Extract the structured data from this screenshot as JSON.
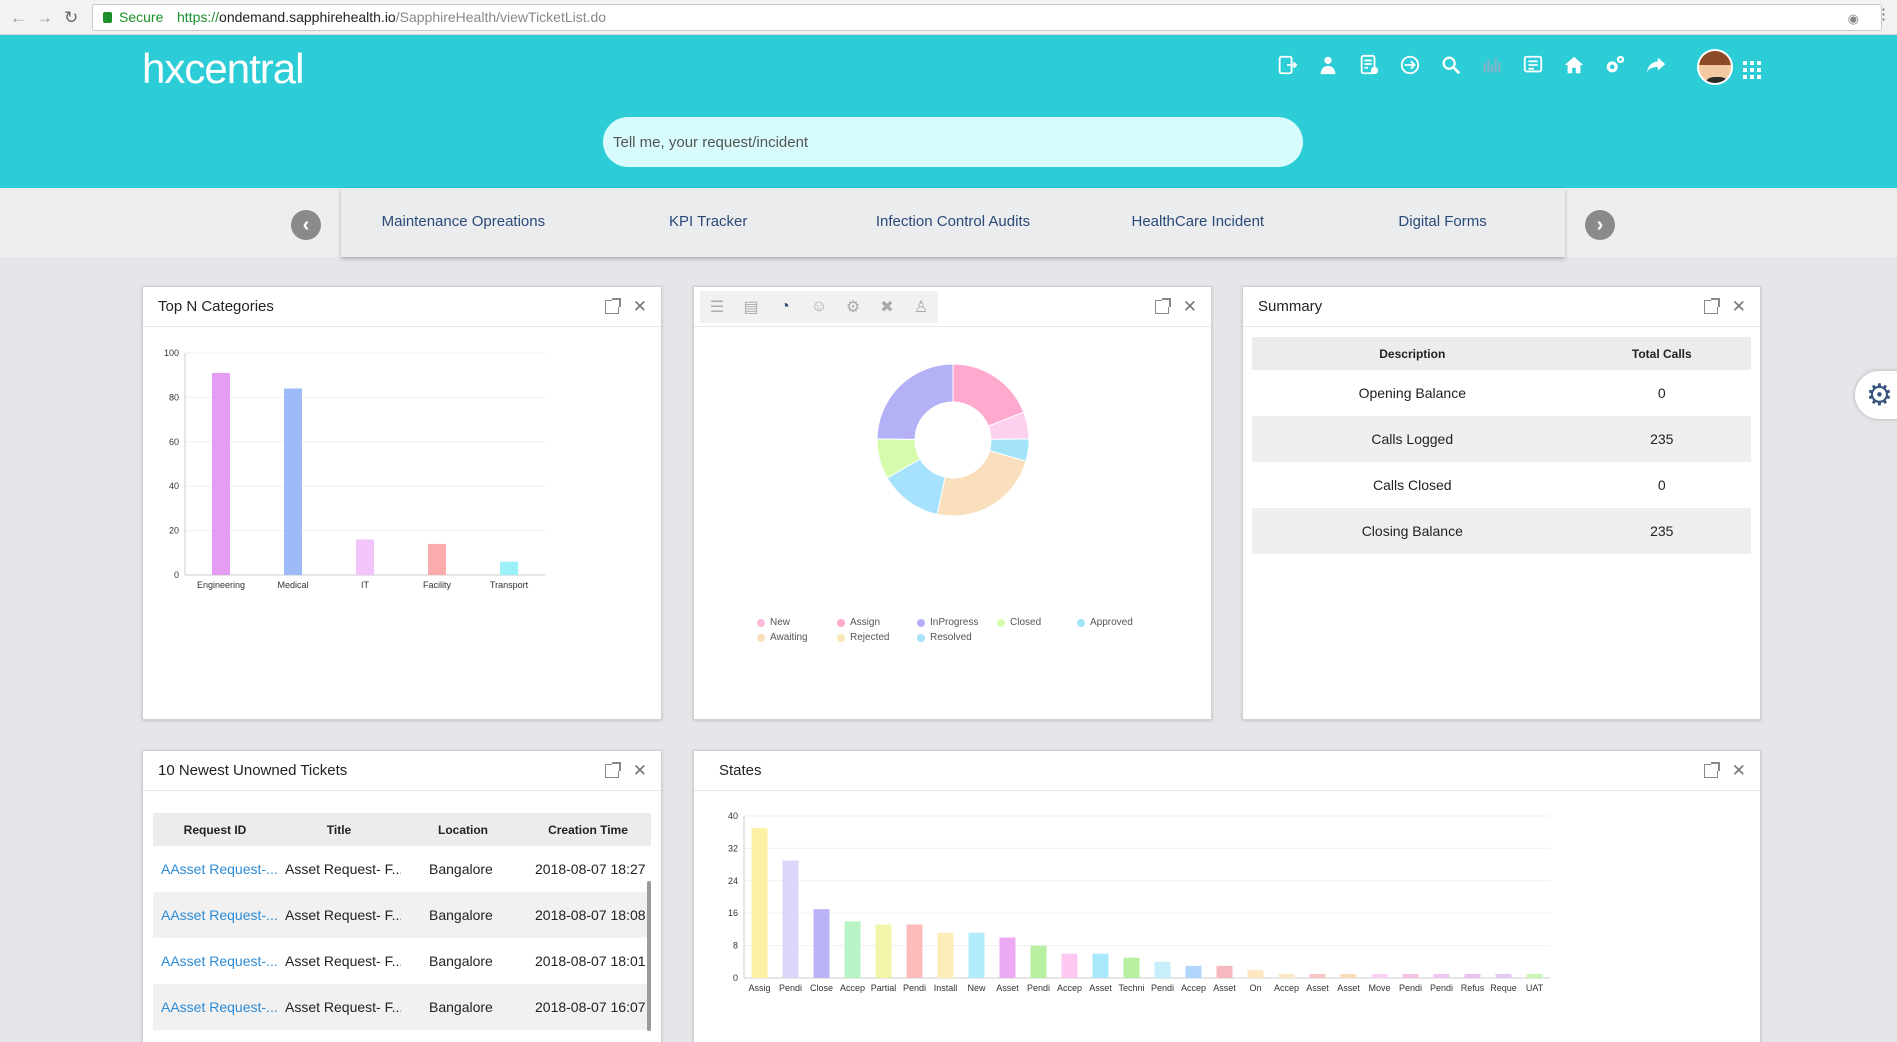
{
  "browser": {
    "secure_label": "Secure",
    "url_protocol": "https://",
    "url_domain": "ondemand.sapphirehealth.io",
    "url_path": "/SapphireHealth/viewTicketList.do"
  },
  "header": {
    "logo": "hxcentral",
    "search_placeholder": "Tell me, your request/incident",
    "icons": [
      "logout-icon",
      "user-icon",
      "checklist-icon",
      "signin-icon",
      "search-icon",
      "chart-icon",
      "list-icon",
      "home-icon",
      "settings-icon",
      "share-icon"
    ]
  },
  "carousel": {
    "items": [
      "Maintenance Opreations",
      "KPI Tracker",
      "Infection Control Audits",
      "HealthCare Incident",
      "Digital Forms"
    ]
  },
  "top_categories": {
    "title": "Top N Categories",
    "chart_data": {
      "type": "bar",
      "categories": [
        "Engineering",
        "Medical",
        "IT",
        "Facility",
        "Transport"
      ],
      "values": [
        91,
        84,
        16,
        14,
        6
      ],
      "colors": [
        "#e59df4",
        "#9dbbf9",
        "#f3c3fb",
        "#fbabab",
        "#9cf1f9"
      ],
      "ylim": [
        0,
        100
      ],
      "yticks": [
        "0",
        "20",
        "40",
        "60",
        "80",
        "100"
      ]
    }
  },
  "status_donut": {
    "tabs": [
      "list-icon",
      "bar-icon",
      "pie-icon",
      "smile-icon",
      "gear-icon",
      "tools-icon",
      "users-icon"
    ],
    "chart_data": {
      "type": "pie",
      "labels": [
        "Assign",
        "Rejected",
        "Approved",
        "Awaiting",
        "Resolved",
        "Closed",
        "InProgress"
      ],
      "values": [
        20,
        6,
        5,
        25,
        14,
        9,
        26
      ],
      "colors": [
        "#fea9cd",
        "#fed0f0",
        "#a3e4fb",
        "#f9dfbb",
        "#a6e2fb",
        "#d7fbac",
        "#b4b1f6"
      ]
    },
    "legend": [
      {
        "label": "New",
        "color": "#fbbad9"
      },
      {
        "label": "Assign",
        "color": "#fea9cd"
      },
      {
        "label": "InProgress",
        "color": "#b4b1f6"
      },
      {
        "label": "Closed",
        "color": "#d7fbac"
      },
      {
        "label": "Approved",
        "color": "#a3e4fb"
      },
      {
        "label": "Awaiting",
        "color": "#f9dfbb"
      },
      {
        "label": "Rejected",
        "color": "#f9e5b5"
      },
      {
        "label": "Resolved",
        "color": "#a6e2fb"
      }
    ]
  },
  "summary": {
    "title": "Summary",
    "headers": [
      "Description",
      "Total Calls"
    ],
    "rows": [
      [
        "Opening Balance",
        "0"
      ],
      [
        "Calls Logged",
        "235"
      ],
      [
        "Calls Closed",
        "0"
      ],
      [
        "Closing Balance",
        "235"
      ]
    ]
  },
  "tickets": {
    "title": "10 Newest Unowned Tickets",
    "headers": [
      "Request ID",
      "Title",
      "Location",
      "Creation Time"
    ],
    "rows": [
      [
        "AAsset Request-...",
        "Asset Request- F...",
        "Bangalore",
        "2018-08-07 18:27"
      ],
      [
        "AAsset Request-...",
        "Asset Request- F...",
        "Bangalore",
        "2018-08-07 18:08"
      ],
      [
        "AAsset Request-...",
        "Asset Request- F...",
        "Bangalore",
        "2018-08-07 18:01"
      ],
      [
        "AAsset Request-...",
        "Asset Request- F...",
        "Bangalore",
        "2018-08-07 16:07"
      ]
    ]
  },
  "states": {
    "title": "States",
    "chart_data": {
      "type": "bar",
      "categories": [
        "Assig",
        "Pendi",
        "Close",
        "Accep",
        "Partial",
        "Pendi",
        "Install",
        "New",
        "Asset",
        "Pendi",
        "Accep",
        "Asset",
        "Techni",
        "Pendi",
        "Accep",
        "Asset",
        "On",
        "Accep",
        "Asset",
        "Asset",
        "Move",
        "Pendi",
        "Pendi",
        "Refus",
        "Reque",
        "UAT"
      ],
      "values": [
        37,
        29,
        17,
        14,
        13.2,
        13.2,
        11.2,
        11.2,
        10,
        8,
        6,
        6,
        5,
        4,
        3,
        3,
        2,
        1,
        1,
        1,
        1,
        1,
        1,
        1,
        1,
        1
      ],
      "colors": [
        "#fdf0a4",
        "#dcd6fb",
        "#b9b4f6",
        "#b8f4c6",
        "#f2f4a9",
        "#fdbcbc",
        "#fdebb9",
        "#b3ecfa",
        "#ecaaf2",
        "#b6f0a0",
        "#fdc8f1",
        "#a9e8fa",
        "#b6f0a0",
        "#c6eefb",
        "#b1d6fb",
        "#f7b9c0",
        "#fde6c2",
        "#fbe7c5",
        "#f9c6c6",
        "#fbdcb9",
        "#fbd0f4",
        "#f4c2e5",
        "#f1c5f4",
        "#eec0f2",
        "#e4c8f8",
        "#c8f7b8"
      ],
      "ylim": [
        0,
        40
      ],
      "yticks": [
        "0",
        "8",
        "16",
        "24",
        "32",
        "40"
      ]
    }
  }
}
